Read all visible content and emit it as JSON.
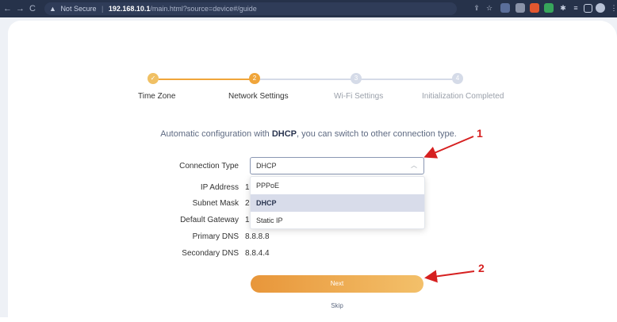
{
  "browser": {
    "nav_back": "←",
    "nav_forward": "→",
    "nav_reload": "C",
    "warning_icon": "▲",
    "security_text": "Not Secure",
    "url_host": "192.168.10.1",
    "url_path": "/main.html?source=device#/guide"
  },
  "stepper": {
    "steps": [
      {
        "label": "Time Zone",
        "mark": "✓",
        "state": "done"
      },
      {
        "label": "Network Settings",
        "mark": "2",
        "state": "active"
      },
      {
        "label": "Wi-Fi Settings",
        "mark": "3",
        "state": "pending"
      },
      {
        "label": "Initialization Completed",
        "mark": "4",
        "state": "pending"
      }
    ]
  },
  "headline": {
    "prefix": "Automatic configuration with ",
    "bold": "DHCP",
    "suffix": ", you can switch to other connection type."
  },
  "form": {
    "connection_type_label": "Connection Type",
    "connection_type_value": "DHCP",
    "options": [
      "PPPoE",
      "DHCP",
      "Static IP"
    ],
    "selected_option": "DHCP",
    "ip_address_label": "IP Address",
    "ip_address_value": "19",
    "subnet_mask_label": "Subnet Mask",
    "subnet_mask_value": "25",
    "default_gateway_label": "Default Gateway",
    "default_gateway_value": "19",
    "primary_dns_label": "Primary DNS",
    "primary_dns_value": "8.8.8.8",
    "secondary_dns_label": "Secondary DNS",
    "secondary_dns_value": "8.8.4.4"
  },
  "actions": {
    "next_label": "Next",
    "skip_label": "Skip"
  },
  "annotations": {
    "marker_1": "1",
    "marker_2": "2"
  },
  "colors": {
    "accent": "#f0a53a",
    "pending": "#d5dbe8",
    "annotation": "#d62020"
  }
}
